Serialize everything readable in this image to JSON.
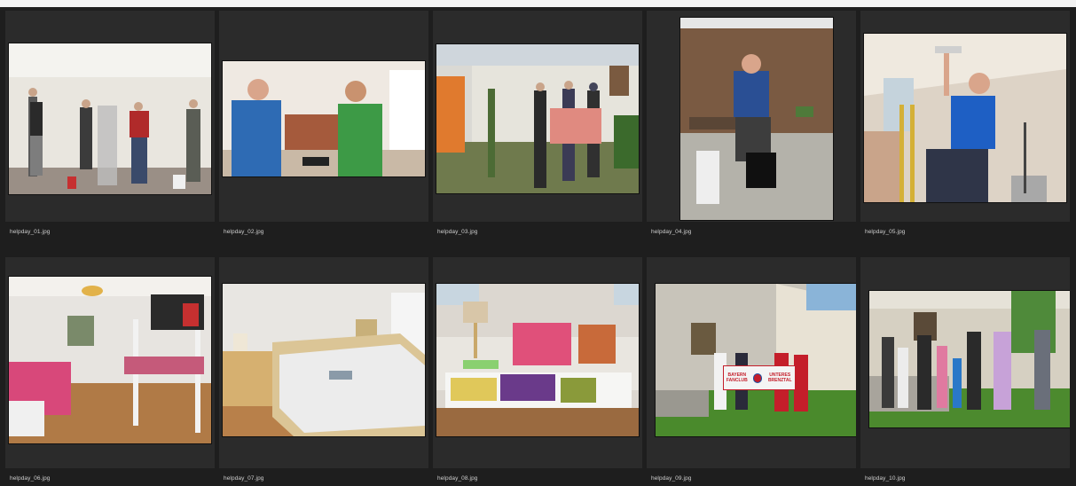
{
  "files": [
    {
      "name": "helpday_01.jpg"
    },
    {
      "name": "helpday_02.jpg"
    },
    {
      "name": "helpday_03.jpg"
    },
    {
      "name": "helpday_04.jpg"
    },
    {
      "name": "helpday_05.jpg"
    },
    {
      "name": "helpday_06.jpg"
    },
    {
      "name": "helpday_07.jpg"
    },
    {
      "name": "helpday_08.jpg"
    },
    {
      "name": "helpday_09.jpg"
    },
    {
      "name": "helpday_10.jpg"
    }
  ],
  "banner": {
    "left": "BAYERN FANCLUB",
    "right": "UNTERES BRENZTAL"
  },
  "colors": {
    "background": "#1e1e1e",
    "cell": "#262626",
    "label": "#cfcfcf",
    "fcbayern_red": "#d01c2a"
  }
}
